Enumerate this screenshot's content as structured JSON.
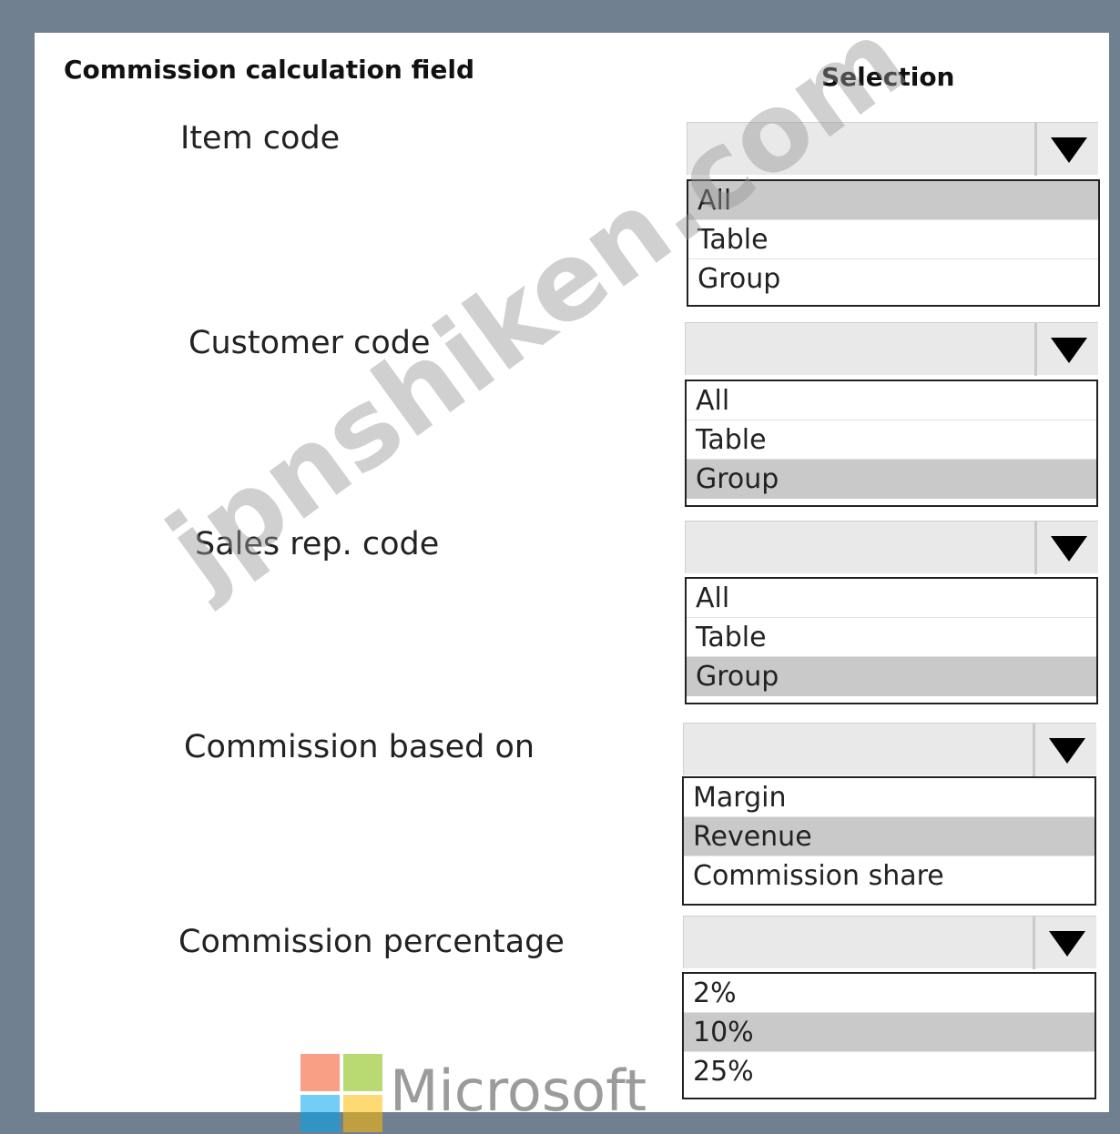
{
  "headers": {
    "field": "Commission calculation field",
    "selection": "Selection"
  },
  "fields": [
    {
      "label": "Item code",
      "options": [
        "All",
        "Table",
        "Group"
      ],
      "selected": "All"
    },
    {
      "label": "Customer code",
      "options": [
        "All",
        "Table",
        "Group"
      ],
      "selected": "Group"
    },
    {
      "label": "Sales rep. code",
      "options": [
        "All",
        "Table",
        "Group"
      ],
      "selected": "Group"
    },
    {
      "label": "Commission based on",
      "options": [
        "Margin",
        "Revenue",
        "Commission share"
      ],
      "selected": "Revenue"
    },
    {
      "label": "Commission percentage",
      "options": [
        "2%",
        "10%",
        "25%"
      ],
      "selected": "10%"
    }
  ],
  "watermark": "jpnshiken.com",
  "brand": {
    "name": "Microsoft",
    "colors": [
      "#f25022",
      "#7fba00",
      "#00a4ef",
      "#ffb900"
    ]
  }
}
